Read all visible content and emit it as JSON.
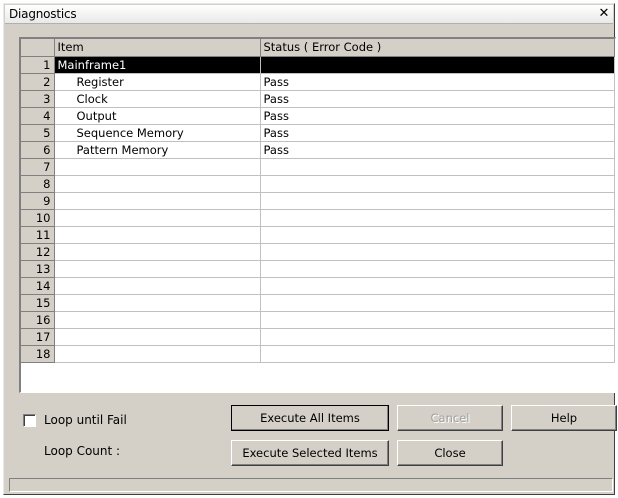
{
  "window": {
    "title": "Diagnostics",
    "close_glyph": "✕"
  },
  "grid": {
    "columns": [
      "Item",
      "Status ( Error Code )"
    ],
    "rows": [
      {
        "num": "1",
        "item": "Mainframe1",
        "status": "",
        "indent": false,
        "selected": true
      },
      {
        "num": "2",
        "item": "Register",
        "status": "Pass",
        "indent": true,
        "selected": false
      },
      {
        "num": "3",
        "item": "Clock",
        "status": "Pass",
        "indent": true,
        "selected": false
      },
      {
        "num": "4",
        "item": "Output",
        "status": "Pass",
        "indent": true,
        "selected": false
      },
      {
        "num": "5",
        "item": "Sequence Memory",
        "status": "Pass",
        "indent": true,
        "selected": false
      },
      {
        "num": "6",
        "item": "Pattern Memory",
        "status": "Pass",
        "indent": true,
        "selected": false
      },
      {
        "num": "7",
        "item": "",
        "status": "",
        "indent": false,
        "selected": false
      },
      {
        "num": "8",
        "item": "",
        "status": "",
        "indent": false,
        "selected": false
      },
      {
        "num": "9",
        "item": "",
        "status": "",
        "indent": false,
        "selected": false
      },
      {
        "num": "10",
        "item": "",
        "status": "",
        "indent": false,
        "selected": false
      },
      {
        "num": "11",
        "item": "",
        "status": "",
        "indent": false,
        "selected": false
      },
      {
        "num": "12",
        "item": "",
        "status": "",
        "indent": false,
        "selected": false
      },
      {
        "num": "13",
        "item": "",
        "status": "",
        "indent": false,
        "selected": false
      },
      {
        "num": "14",
        "item": "",
        "status": "",
        "indent": false,
        "selected": false
      },
      {
        "num": "15",
        "item": "",
        "status": "",
        "indent": false,
        "selected": false
      },
      {
        "num": "16",
        "item": "",
        "status": "",
        "indent": false,
        "selected": false
      },
      {
        "num": "17",
        "item": "",
        "status": "",
        "indent": false,
        "selected": false
      },
      {
        "num": "18",
        "item": "",
        "status": "",
        "indent": false,
        "selected": false
      }
    ]
  },
  "controls": {
    "loop_until_fail_label": "Loop until Fail",
    "loop_until_fail_checked": false,
    "loop_count_label": "Loop Count :",
    "execute_all_label": "Execute All Items",
    "execute_selected_label": "Execute Selected Items",
    "cancel_label": "Cancel",
    "close_label": "Close",
    "help_label": "Help"
  }
}
